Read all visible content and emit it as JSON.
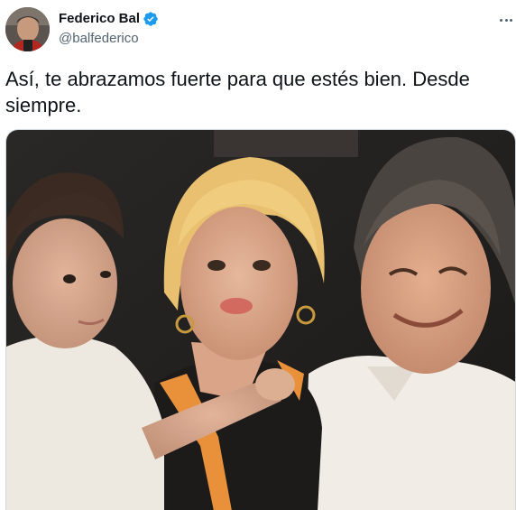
{
  "author": {
    "display_name": "Federico Bal",
    "handle": "@balfederico",
    "verified": true,
    "verified_icon": "verified-badge-icon",
    "verified_color": "#1d9bf0"
  },
  "menu": {
    "icon": "more-options-icon"
  },
  "tweet": {
    "text": "Así, te abrazamos fuerte para que estés bien. Desde siempre."
  },
  "media": {
    "type": "photo"
  },
  "colors": {
    "text_primary": "#0f1419",
    "text_secondary": "#536471",
    "accent": "#1d9bf0"
  }
}
